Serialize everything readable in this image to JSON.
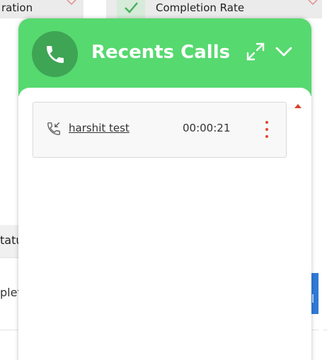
{
  "background": {
    "left_card_text": "ration",
    "right_card_text": "Completion Rate",
    "column_header_text": "tatu",
    "row_text": "plet"
  },
  "widget": {
    "title": "Recents Calls",
    "header_icon": "phone-icon",
    "actions": {
      "expand_icon": "expand-icon",
      "collapse_icon": "chevron-down-icon"
    },
    "colors": {
      "header": "#56d96f",
      "avatar": "#3ea555",
      "menu_dots": "#e0472e"
    }
  },
  "calls": [
    {
      "icon": "incoming-call-icon",
      "name": "harshit test",
      "duration": "00:00:21",
      "menu_icon": "kebab-menu-icon"
    }
  ]
}
